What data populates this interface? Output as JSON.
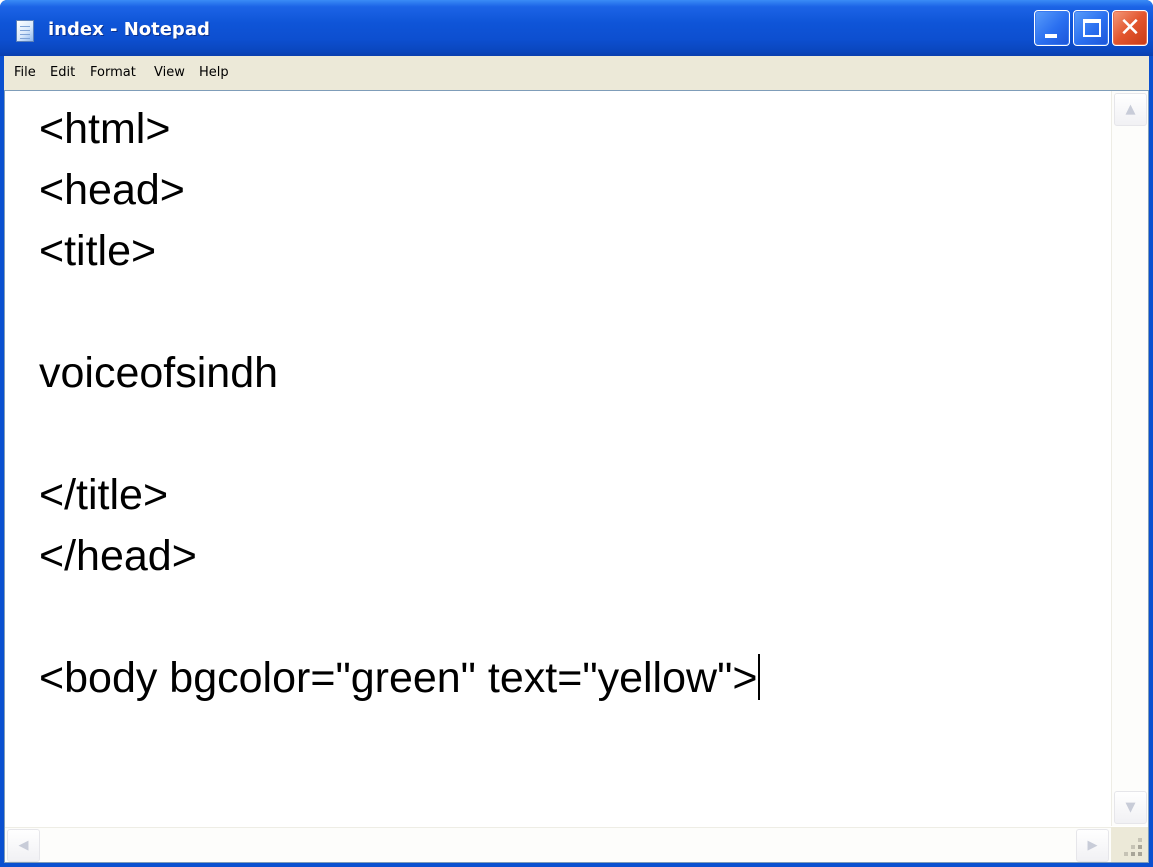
{
  "window": {
    "title": "index - Notepad",
    "icon": "notepad-icon",
    "controls": [
      "minimize-icon",
      "maximize-icon",
      "close-icon"
    ]
  },
  "menu": {
    "items": [
      "File",
      "Edit",
      "Format",
      "View",
      "Help"
    ]
  },
  "editor": {
    "lines": [
      "<html>",
      "<head>",
      "<title>",
      "",
      "voiceofsindh",
      "",
      "</title>",
      "</head>",
      "",
      "<body bgcolor=\"green\" text=\"yellow\">"
    ],
    "caret_line": 9
  },
  "scrollbars": {
    "up": "▲",
    "down": "▼",
    "left": "◀",
    "right": "▶"
  },
  "colors": {
    "titlebar": "#0d4fd0",
    "close_button": "#e2552d",
    "menubar": "#ece9d8",
    "editor_bg": "#ffffff",
    "text": "#000000"
  }
}
